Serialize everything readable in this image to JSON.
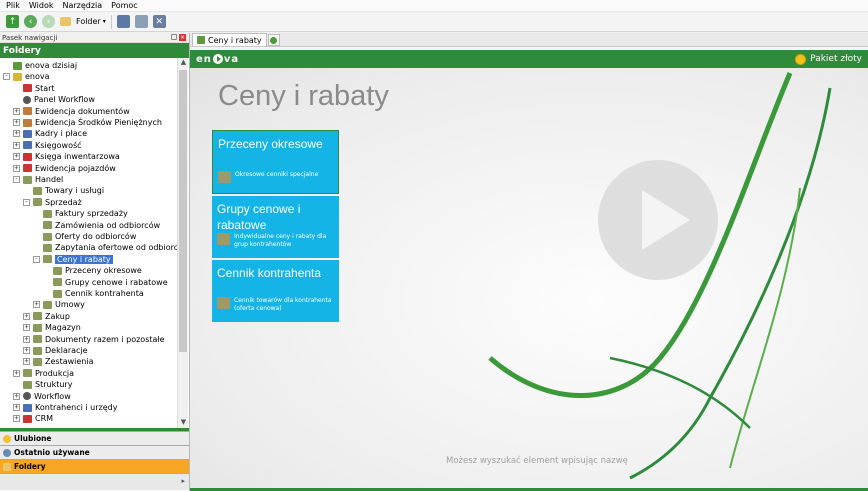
{
  "menu": [
    "Plik",
    "Widok",
    "Narzędzia",
    "Pomoc"
  ],
  "toolbar": {
    "folder_label": "Folder"
  },
  "nav": {
    "header": "Pasek nawigacji",
    "folders_title": "Foldery",
    "tree": [
      {
        "label": "enova dzisiaj",
        "depth": 0,
        "icon": "globe-icon",
        "expander": ""
      },
      {
        "label": "enova",
        "depth": 0,
        "icon": "enova-icon",
        "expander": "-"
      },
      {
        "label": "Start",
        "depth": 1,
        "icon": "start-icon",
        "expander": ""
      },
      {
        "label": "Panel Workflow",
        "depth": 1,
        "icon": "workflow-icon",
        "expander": ""
      },
      {
        "label": "Ewidencja dokumentów",
        "depth": 1,
        "icon": "book-icon",
        "expander": "+"
      },
      {
        "label": "Ewidencja Środków Pieniężnych",
        "depth": 1,
        "icon": "money-icon",
        "expander": "+"
      },
      {
        "label": "Kadry i płace",
        "depth": 1,
        "icon": "people-icon",
        "expander": "+"
      },
      {
        "label": "Księgowość",
        "depth": 1,
        "icon": "ledger-icon",
        "expander": "+"
      },
      {
        "label": "Księga inwentarzowa",
        "depth": 1,
        "icon": "inventory-icon",
        "expander": "+"
      },
      {
        "label": "Ewidencja pojazdów",
        "depth": 1,
        "icon": "car-icon",
        "expander": "+"
      },
      {
        "label": "Handel",
        "depth": 1,
        "icon": "trade-icon",
        "expander": "-"
      },
      {
        "label": "Towary i usługi",
        "depth": 2,
        "icon": "goods-icon",
        "expander": ""
      },
      {
        "label": "Sprzedaż",
        "depth": 2,
        "icon": "sales-icon",
        "expander": "-"
      },
      {
        "label": "Faktury sprzedaży",
        "depth": 3,
        "icon": "folder-icon",
        "expander": ""
      },
      {
        "label": "Zamówienia od odbiorców",
        "depth": 3,
        "icon": "folder-icon",
        "expander": ""
      },
      {
        "label": "Oferty do odbiorców",
        "depth": 3,
        "icon": "folder-icon",
        "expander": ""
      },
      {
        "label": "Zapytania ofertowe od odbiorców",
        "depth": 3,
        "icon": "folder-icon",
        "expander": ""
      },
      {
        "label": "Ceny i rabaty",
        "depth": 3,
        "icon": "folder-icon",
        "expander": "-",
        "selected": true
      },
      {
        "label": "Przeceny okresowe",
        "depth": 4,
        "icon": "folder-icon",
        "expander": ""
      },
      {
        "label": "Grupy cenowe i rabatowe",
        "depth": 4,
        "icon": "folder-icon",
        "expander": ""
      },
      {
        "label": "Cennik kontrahenta",
        "depth": 4,
        "icon": "folder-icon",
        "expander": ""
      },
      {
        "label": "Umowy",
        "depth": 3,
        "icon": "folder-icon",
        "expander": "+"
      },
      {
        "label": "Zakup",
        "depth": 2,
        "icon": "folder-icon",
        "expander": "+"
      },
      {
        "label": "Magazyn",
        "depth": 2,
        "icon": "folder-icon",
        "expander": "+"
      },
      {
        "label": "Dokumenty razem i pozostałe",
        "depth": 2,
        "icon": "folder-icon",
        "expander": "+"
      },
      {
        "label": "Deklaracje",
        "depth": 2,
        "icon": "folder-icon",
        "expander": "+"
      },
      {
        "label": "Zestawienia",
        "depth": 2,
        "icon": "folder-icon",
        "expander": "+"
      },
      {
        "label": "Produkcja",
        "depth": 1,
        "icon": "folder-icon",
        "expander": "+"
      },
      {
        "label": "Struktury",
        "depth": 1,
        "icon": "folder-icon",
        "expander": ""
      },
      {
        "label": "Workflow",
        "depth": 1,
        "icon": "workflow-icon",
        "expander": "+"
      },
      {
        "label": "Kontrahenci i urzędy",
        "depth": 1,
        "icon": "people-icon",
        "expander": "+"
      },
      {
        "label": "CRM",
        "depth": 1,
        "icon": "crm-icon",
        "expander": "+"
      }
    ],
    "bottom": [
      {
        "label": "Ulubione",
        "icon": "star-icon"
      },
      {
        "label": "Ostatnio używane",
        "icon": "clock-icon"
      },
      {
        "label": "Foldery",
        "icon": "folder-icon",
        "active": true
      }
    ]
  },
  "tab": {
    "label": "Ceny i rabaty"
  },
  "header": {
    "logo": "enova",
    "package": "Pakiet złoty"
  },
  "main": {
    "title": "Ceny i rabaty",
    "tiles": [
      {
        "title": "Przeceny okresowe",
        "subtitle": "Okresowe cenniki specjalne"
      },
      {
        "title": "Grupy cenowe i rabatowe",
        "subtitle": "Indywidualne ceny i rabaty dla grup kontrahentów"
      },
      {
        "title": "Cennik kontrahenta",
        "subtitle": "Cennik towarów dla kontrahenta (oferta cenowa)"
      }
    ],
    "search_hint": "Możesz wyszukać element wpisując nazwę"
  },
  "colors": {
    "accent_green": "#2e8b3c",
    "tile_blue": "#14b4e6",
    "selection": "#3875d7",
    "gold": "#f2c11b"
  }
}
